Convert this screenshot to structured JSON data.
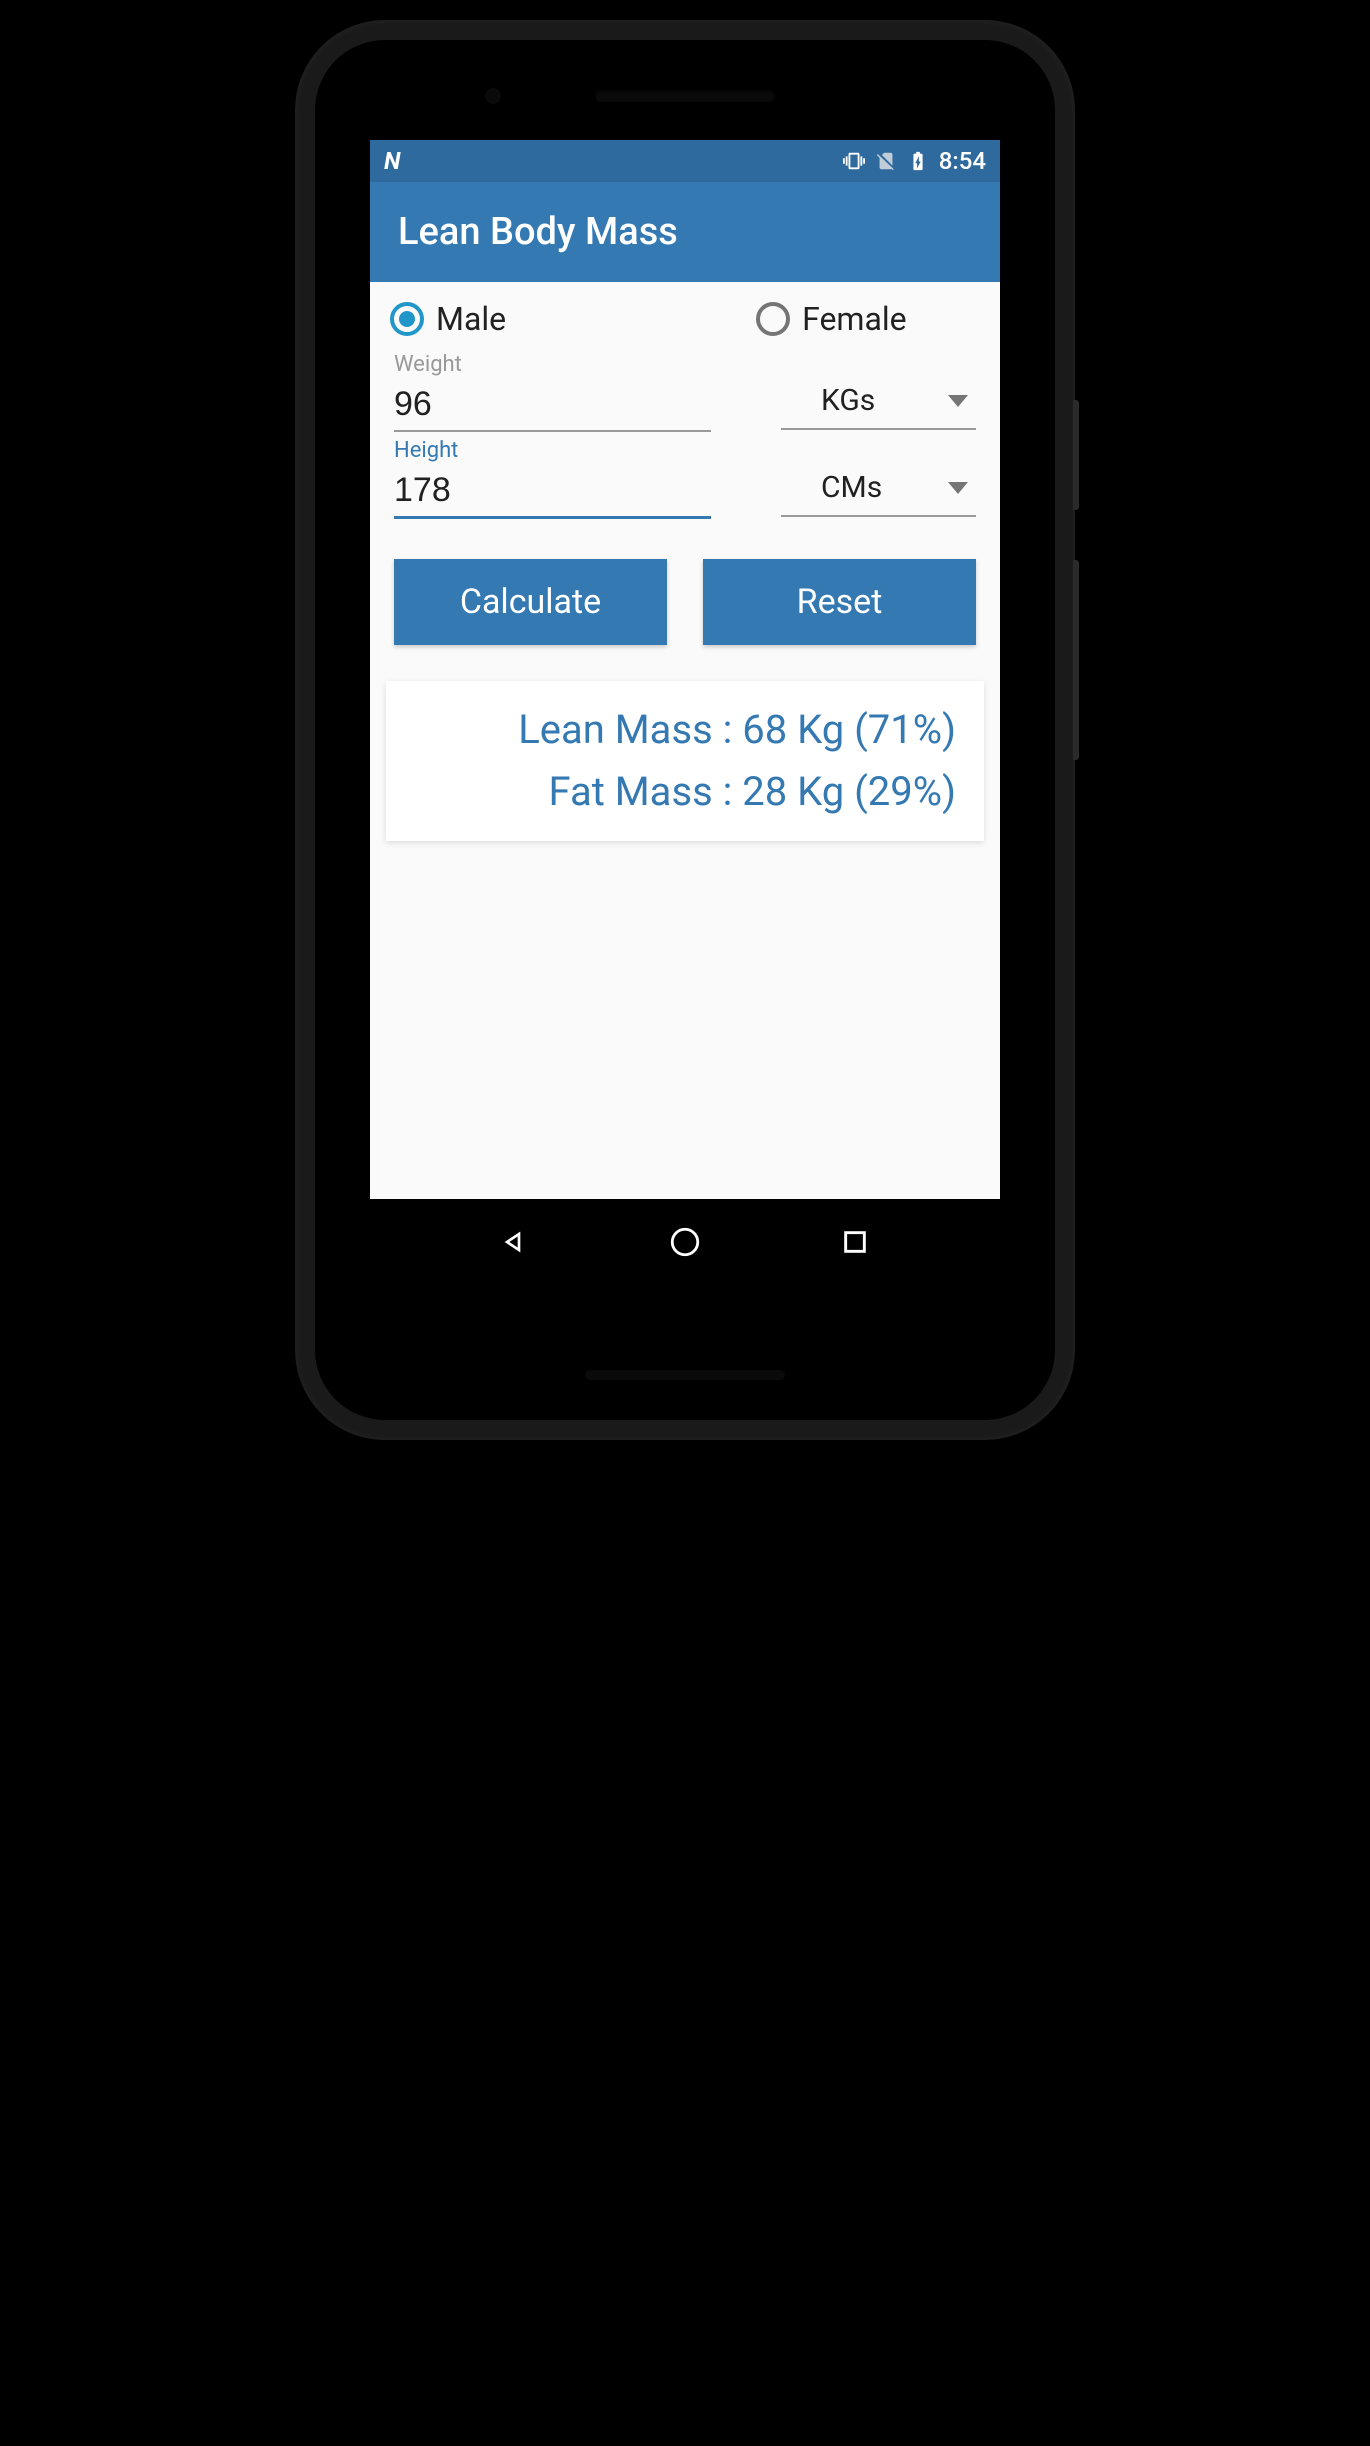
{
  "status_bar": {
    "time": "8:54"
  },
  "app_bar": {
    "title": "Lean Body Mass"
  },
  "gender": {
    "male_label": "Male",
    "female_label": "Female",
    "selected": "male"
  },
  "weight": {
    "label": "Weight",
    "value": "96",
    "unit": "KGs"
  },
  "height": {
    "label": "Height",
    "value": "178",
    "unit": "CMs"
  },
  "buttons": {
    "calculate": "Calculate",
    "reset": "Reset"
  },
  "results": {
    "lean_mass": "Lean Mass :  68 Kg  (71%)",
    "fat_mass": "Fat Mass :  28 Kg  (29%)"
  },
  "colors": {
    "primary": "#3579b3",
    "primary_dark": "#2f6a9e",
    "accent": "#2196c9"
  }
}
